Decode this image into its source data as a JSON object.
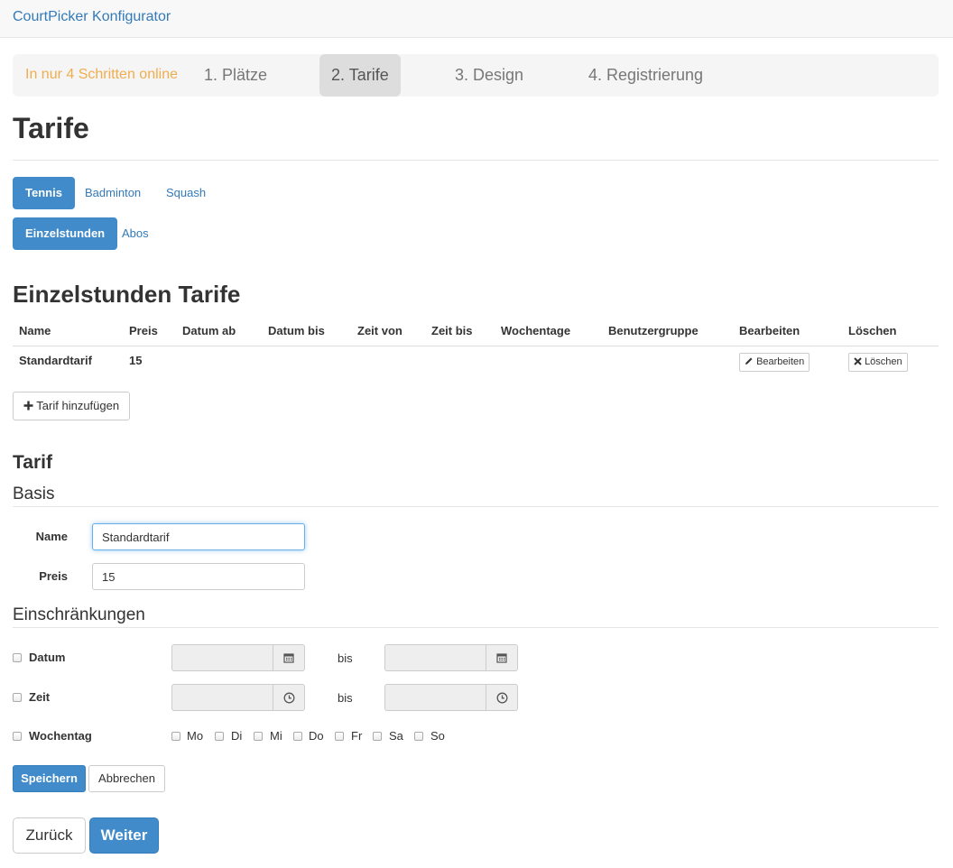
{
  "navbar": {
    "brand": "CourtPicker Konfigurator"
  },
  "steps": {
    "intro": "In nur 4 Schritten online",
    "items": [
      {
        "label": "1. Plätze"
      },
      {
        "label": "2. Tarife",
        "active": true
      },
      {
        "label": "3. Design"
      },
      {
        "label": "4. Registrierung"
      }
    ]
  },
  "page": {
    "title": "Tarife"
  },
  "sport_tabs": [
    "Tennis",
    "Badminton",
    "Squash"
  ],
  "type_tabs": [
    "Einzelstunden",
    "Abos"
  ],
  "table": {
    "title": "Einzelstunden Tarife",
    "headers": [
      "Name",
      "Preis",
      "Datum ab",
      "Datum bis",
      "Zeit von",
      "Zeit bis",
      "Wochentage",
      "Benutzergruppe",
      "Bearbeiten",
      "Löschen"
    ],
    "rows": [
      {
        "name": "Standardtarif",
        "price": "15",
        "edit": "Bearbeiten",
        "delete": "Löschen"
      }
    ],
    "add_button": "Tarif hinzufügen"
  },
  "form": {
    "title": "Tarif",
    "basis_legend": "Basis",
    "name_label": "Name",
    "name_value": "Standardtarif",
    "price_label": "Preis",
    "price_value": "15",
    "restrictions_legend": "Einschränkungen",
    "date_label": "Datum",
    "time_label": "Zeit",
    "weekday_label": "Wochentag",
    "bis": "bis",
    "weekdays": [
      "Mo",
      "Di",
      "Mi",
      "Do",
      "Fr",
      "Sa",
      "So"
    ],
    "save": "Speichern",
    "cancel": "Abbrechen"
  },
  "footer": {
    "back": "Zurück",
    "next": "Weiter"
  },
  "colors": {
    "primary": "#428bca",
    "link": "#337ab7",
    "intro": "#f0ad4e"
  },
  "icons": [
    "pencil-icon",
    "close-icon",
    "plus-icon",
    "calendar-icon",
    "clock-icon"
  ]
}
